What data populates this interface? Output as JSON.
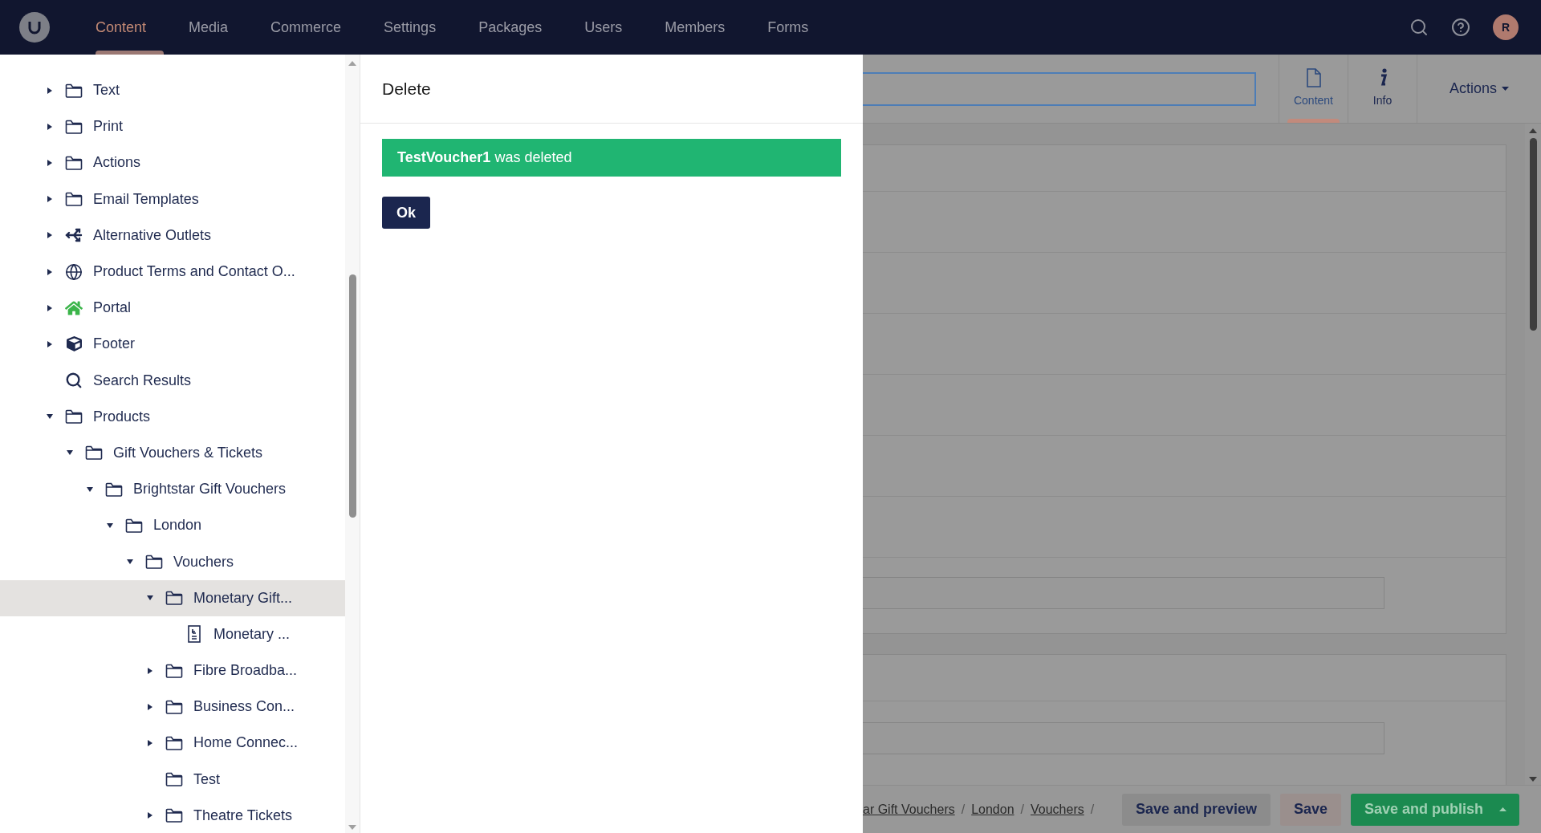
{
  "header": {
    "nav": [
      {
        "label": "Content",
        "selected": true
      },
      {
        "label": "Media",
        "selected": false
      },
      {
        "label": "Commerce",
        "selected": false
      },
      {
        "label": "Settings",
        "selected": false
      },
      {
        "label": "Packages",
        "selected": false
      },
      {
        "label": "Users",
        "selected": false
      },
      {
        "label": "Members",
        "selected": false
      },
      {
        "label": "Forms",
        "selected": false
      }
    ],
    "avatar_initial": "R"
  },
  "tree": {
    "items": [
      {
        "label": "Text",
        "kind": "folder",
        "has_children": true,
        "expanded": false,
        "selected": false
      },
      {
        "label": "Print",
        "kind": "folder",
        "has_children": true,
        "expanded": false,
        "selected": false
      },
      {
        "label": "Actions",
        "kind": "folder",
        "has_children": true,
        "expanded": false,
        "selected": false
      },
      {
        "label": "Email Templates",
        "kind": "folder",
        "has_children": true,
        "expanded": false,
        "selected": false
      },
      {
        "label": "Alternative Outlets",
        "kind": "outlets",
        "has_children": true,
        "expanded": false,
        "selected": false
      },
      {
        "label": "Product Terms and Contact O...",
        "kind": "globe",
        "has_children": true,
        "expanded": false,
        "selected": false
      },
      {
        "label": "Portal",
        "kind": "home",
        "has_children": true,
        "expanded": false,
        "selected": false
      },
      {
        "label": "Footer",
        "kind": "box",
        "has_children": true,
        "expanded": false,
        "selected": false
      },
      {
        "label": "Search Results",
        "kind": "search",
        "has_children": false,
        "expanded": false,
        "selected": false
      },
      {
        "label": "Products",
        "kind": "folder",
        "has_children": true,
        "expanded": true,
        "selected": false,
        "children": [
          {
            "label": "Gift Vouchers & Tickets",
            "kind": "folder",
            "has_children": true,
            "expanded": true,
            "selected": false,
            "children": [
              {
                "label": "Brightstar Gift Vouchers",
                "kind": "folder",
                "has_children": true,
                "expanded": true,
                "selected": false,
                "children": [
                  {
                    "label": "London",
                    "kind": "folder",
                    "has_children": true,
                    "expanded": true,
                    "selected": false,
                    "children": [
                      {
                        "label": "Vouchers",
                        "kind": "folder",
                        "has_children": true,
                        "expanded": true,
                        "selected": false,
                        "children": [
                          {
                            "label": "Monetary Gift...",
                            "kind": "folder",
                            "has_children": true,
                            "expanded": true,
                            "selected": true,
                            "children": [
                              {
                                "label": "Monetary ...",
                                "kind": "voucher",
                                "has_children": false,
                                "expanded": false,
                                "selected": false
                              }
                            ]
                          },
                          {
                            "label": "Fibre Broadba...",
                            "kind": "folder",
                            "has_children": true,
                            "expanded": false,
                            "selected": false
                          },
                          {
                            "label": "Business Con...",
                            "kind": "folder",
                            "has_children": true,
                            "expanded": false,
                            "selected": false
                          },
                          {
                            "label": "Home Connec...",
                            "kind": "folder",
                            "has_children": true,
                            "expanded": false,
                            "selected": false
                          },
                          {
                            "label": "Test",
                            "kind": "folder",
                            "has_children": false,
                            "expanded": false,
                            "selected": false
                          },
                          {
                            "label": "Theatre Tickets",
                            "kind": "folder",
                            "has_children": true,
                            "expanded": false,
                            "selected": false
                          }
                        ]
                      }
                    ]
                  }
                ]
              }
            ]
          }
        ]
      }
    ]
  },
  "dialog": {
    "title": "Delete",
    "message": "**TestVoucher1** was deleted",
    "ok_button": "Ok"
  },
  "editor": {
    "apps": [
      {
        "label": "Content",
        "selected": true
      },
      {
        "label": "Info",
        "selected": false
      }
    ],
    "actions_button": "Actions",
    "breadcrumb": [
      {
        "label": "ar Gift Vouchers",
        "separator": "/"
      },
      {
        "label": "London",
        "separator": "/"
      },
      {
        "label": "Vouchers",
        "separator": "/"
      }
    ],
    "save_and_preview_button": "Save and preview",
    "save_button": "Save",
    "save_and_publish_button": "Save and publish"
  }
}
